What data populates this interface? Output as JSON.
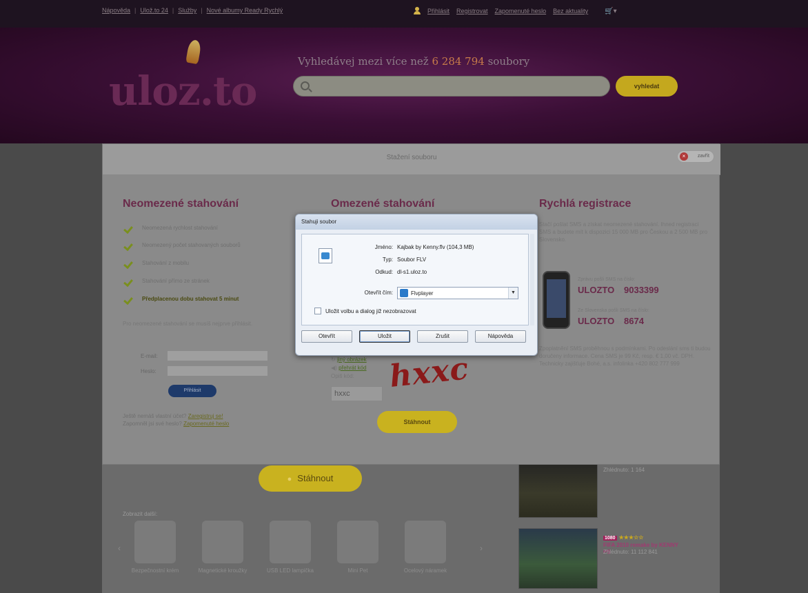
{
  "topbar": {
    "links": [
      "Nápověda",
      "Ulož.to 24",
      "Služby",
      "Nové albumy Ready Rychlý"
    ],
    "login": "Přihlásit",
    "register": "Registrovat",
    "forgot": "Zapomenuté heslo",
    "cart": "Bez aktuality",
    "cart_icon": "cart-icon"
  },
  "header": {
    "logo": "uloz.to",
    "search_headline_prefix": "Vyhledávej mezi více než",
    "search_count": "6 284 794",
    "search_headline_suffix": "soubory",
    "search_placeholder": "",
    "search_button": "vyhledat"
  },
  "overlay": {
    "title": "Stažení souboru",
    "close": "zavřít"
  },
  "unlimited": {
    "title": "Neomezené stahování",
    "features": [
      "Neomezená rychlost stahování",
      "Neomezený počet stahovaných souborů",
      "Stahování z mobilu",
      "Stahování přímo ze stránek",
      "Předplacenou dobu stahovat 5 minut"
    ],
    "note": "Pro neomezené stahování se musíš nejprve přihlásit.",
    "email_label": "E-mail:",
    "password_label": "Heslo:",
    "login_button": "Přihlásit",
    "footer_line1_text": "Ještě nemáš vlastní účet?",
    "footer_line1_link": "Zaregistruj se!",
    "footer_line2_text": "Zapomněl jsi své heslo?",
    "footer_line2_link": "Zapomenuté heslo"
  },
  "limited": {
    "title": "Omezené stahování",
    "captcha_link1": "jiný obrázek",
    "captcha_link2": "přehrát kód",
    "captcha_hint": "Opiš kód:",
    "captcha_value": "hxxc",
    "captcha_image_text": "hxxc",
    "submit": "Stáhnout"
  },
  "registration": {
    "title": "Rychlá registrace",
    "text": "Stačí pošlat SMS a získat neomezené stahování. Ihned registraci SMS a budete mít k dispozici 15 000 MB pro Českou a 2 500 MB pro Slovensko.",
    "sms_label1": "Zprávu pošli SMS na číslo:",
    "sms_code1_a": "ULOZTO",
    "sms_code1_b": "9033399",
    "sms_label2": "Ze Slovenska pošli SMS na číslo:",
    "sms_code2_a": "ULOZTO",
    "sms_code2_b": "8674",
    "na": "na",
    "text2": "Zpoplatnění SMS proběhnou s podmínkami. Po odeslání sms ti budou doručeny informace. Cena SMS je 99 Kč, resp. € 1,00 vč. DPH. Technicky zajišťuje Bohé, a.s. infolinka +420 802 777 999"
  },
  "dialog": {
    "title": "Stahuji soubor",
    "name_label": "Jméno:",
    "name_value": "Kajbak by Kenny.flv (104,3 MB)",
    "type_label": "Typ:",
    "type_value": "Soubor FLV",
    "from_label": "Odkud:",
    "from_value": "dl-s1.uloz.to",
    "open_with_label": "Otevřít čím:",
    "open_with_value": "Flvplayer",
    "remember": "Uložit volbu a dialog již nezobrazovat",
    "btn_open": "Otevřít",
    "btn_save": "Uložit",
    "btn_cancel": "Zrušit",
    "btn_help": "Nápověda"
  },
  "page": {
    "download_button": "Stáhnout",
    "related_label": "Zobrazit další:",
    "products": [
      {
        "caption": "Bezpečnostní krém"
      },
      {
        "caption": "Magnetické kroužky"
      },
      {
        "caption": "USB LED lampička"
      },
      {
        "caption": "Mini Pet"
      },
      {
        "caption": "Ocelový náramek"
      }
    ],
    "sidebar": {
      "sub1": "Zhlédnuto: 1 164",
      "badge": "1080",
      "stars": "★★★☆☆",
      "title2": "FIFA 2010 remake by KENNY PS",
      "sub2": "Zhlédnuto: 11 112 841"
    }
  }
}
